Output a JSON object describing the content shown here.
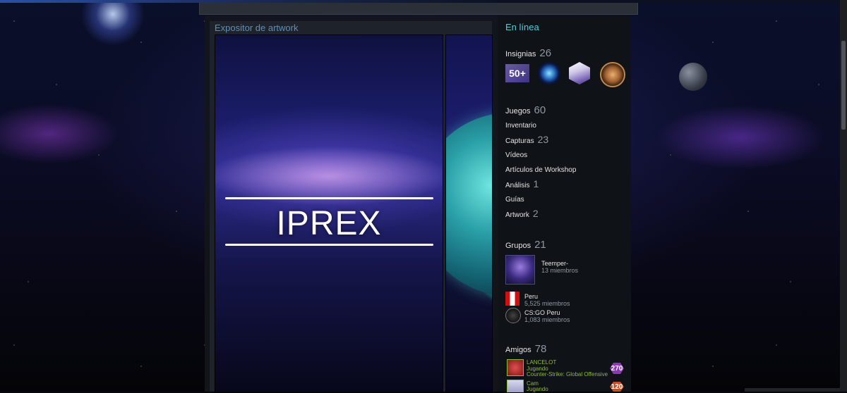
{
  "artwork": {
    "title": "Expositor de artwork",
    "logo_text": "IPREX"
  },
  "profile": {
    "status": "En línea"
  },
  "badges": {
    "label": "Insignias",
    "count": "26",
    "items": [
      {
        "name": "badge-50-plus",
        "text": "50+"
      },
      {
        "name": "badge-orb"
      },
      {
        "name": "badge-cube"
      },
      {
        "name": "badge-emblem"
      }
    ]
  },
  "links": {
    "games": {
      "label": "Juegos",
      "count": "60"
    },
    "inventory": {
      "label": "Inventario"
    },
    "screenshots": {
      "label": "Capturas",
      "count": "23"
    },
    "videos": {
      "label": "Vídeos"
    },
    "workshop": {
      "label": "Artículos de Workshop"
    },
    "reviews": {
      "label": "Análisis",
      "count": "1"
    },
    "guides": {
      "label": "Guías"
    },
    "artwork": {
      "label": "Artwork",
      "count": "2"
    }
  },
  "groups": {
    "label": "Grupos",
    "count": "21",
    "items": [
      {
        "name": "Teemper-",
        "members": "13 miembros"
      },
      {
        "name": "Peru",
        "members": "5,525 miembros"
      },
      {
        "name": "CS:GO Peru",
        "members": "1,083 miembros"
      }
    ]
  },
  "friends": {
    "label": "Amigos",
    "count": "78",
    "items": [
      {
        "name": "LANCELOT",
        "status": "Jugando",
        "game": "Counter-Strike: Global Offensive",
        "level": "270",
        "level_color": "#8a3ab0"
      },
      {
        "name": "Cam",
        "status": "Jugando",
        "level": "120",
        "level_color": "#c0502a"
      }
    ]
  },
  "colors": {
    "online": "#57cbde",
    "ingame": "#8fb93b",
    "muted": "#8f98a0"
  }
}
